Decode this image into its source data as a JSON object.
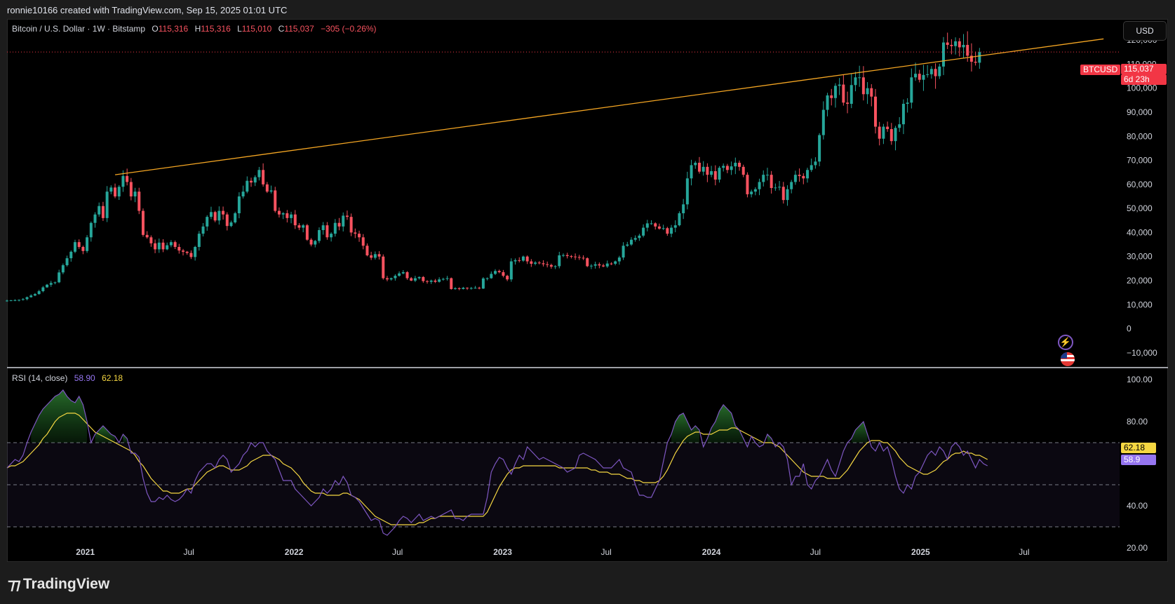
{
  "header": {
    "credit": "ronnie10166 created with TradingView.com, Sep 15, 2025 01:01 UTC"
  },
  "legend": {
    "symbol": "Bitcoin / U.S. Dollar · 1W · Bitstamp",
    "o_label": "O",
    "o_value": "115,316",
    "h_label": "H",
    "h_value": "115,316",
    "l_label": "L",
    "l_value": "115,010",
    "c_label": "C",
    "c_value": "115,037",
    "change": "−305 (−0.26%)"
  },
  "currency_button": "USD",
  "price_tag": {
    "symbol": "BTCUSD",
    "price": "115,037",
    "countdown": "6d 23h"
  },
  "rsi_legend": {
    "title": "RSI (14, close)",
    "rsi": "58.90",
    "ma": "62.18"
  },
  "footer": {
    "brand": "TradingView"
  },
  "colors": {
    "up": "#26a69a",
    "down": "#f7525f",
    "trendline": "#f5a623",
    "rsi_line": "#7e57c2",
    "rsi_ma": "#f5d742"
  },
  "chart_data": [
    {
      "type": "candlestick",
      "ylim": [
        -15000,
        125000
      ],
      "y_ticks": [
        "120,000",
        "110,000",
        "100,000",
        "90,000",
        "80,000",
        "70,000",
        "60,000",
        "50,000",
        "40,000",
        "30,000",
        "20,000",
        "10,000",
        "0",
        "−10,000"
      ],
      "y_tick_values": [
        120000,
        110000,
        100000,
        90000,
        80000,
        70000,
        60000,
        50000,
        40000,
        30000,
        20000,
        10000,
        0,
        -10000
      ],
      "x_ticks": [
        "2021",
        "Jul",
        "2022",
        "Jul",
        "2023",
        "Jul",
        "2024",
        "Jul",
        "2025",
        "Jul"
      ],
      "x_tick_dates": [
        "2021-01-01",
        "2021-07-01",
        "2022-01-01",
        "2022-07-01",
        "2023-01-01",
        "2023-07-01",
        "2024-01-01",
        "2024-07-01",
        "2025-01-01",
        "2025-07-01"
      ],
      "x_range": [
        "2020-08-17",
        "2025-12-15"
      ],
      "last_price": 115037,
      "trendline": [
        [
          "2021-02-22",
          64000
        ],
        [
          "2025-11-17",
          120500
        ]
      ],
      "weekly_closes": [
        11700,
        11800,
        11900,
        12000,
        12300,
        13100,
        13800,
        14400,
        15600,
        17200,
        18300,
        19000,
        19300,
        23400,
        26400,
        29300,
        32000,
        36000,
        34000,
        32300,
        38000,
        44000,
        47500,
        51000,
        46000,
        57000,
        58700,
        55000,
        59000,
        63500,
        61000,
        55000,
        57000,
        49000,
        39000,
        38000,
        35500,
        33000,
        35800,
        33000,
        34700,
        36000,
        34000,
        32500,
        32000,
        31500,
        29800,
        34000,
        39500,
        42500,
        46500,
        48500,
        45000,
        49000,
        47500,
        42700,
        44200,
        48000,
        55000,
        57000,
        61500,
        60800,
        63000,
        66000,
        60000,
        57000,
        57500,
        49000,
        47500,
        48000,
        46000,
        47500,
        43000,
        42000,
        43000,
        37000,
        35000,
        36500,
        41000,
        43000,
        38000,
        39500,
        44000,
        42500,
        47000,
        46500,
        40000,
        39500,
        38000,
        34500,
        30500,
        29500,
        31000,
        30000,
        21000,
        20500,
        21000,
        22000,
        23000,
        23500,
        21000,
        20000,
        21000,
        21500,
        19800,
        19500,
        20000,
        19500,
        20500,
        20700,
        21000,
        16500,
        16800,
        16500,
        17000,
        16800,
        16900,
        17000,
        16700,
        20900,
        21000,
        22800,
        24000,
        23500,
        22000,
        20500,
        28000,
        28500,
        28300,
        30000,
        28000,
        27000,
        27500,
        27200,
        26800,
        26500,
        25800,
        26000,
        30500,
        30600,
        30200,
        30000,
        29800,
        29500,
        29300,
        26000,
        26200,
        26800,
        26300,
        25900,
        27100,
        27000,
        28000,
        29600,
        34500,
        35000,
        37000,
        37700,
        38700,
        42000,
        43800,
        43800,
        42500,
        41600,
        41800,
        39500,
        42000,
        43000,
        48000,
        51700,
        62500,
        68000,
        69000,
        65300,
        67300,
        64000,
        65500,
        62000,
        66900,
        67700,
        66000,
        67500,
        69000,
        67300,
        64000,
        55900,
        57000,
        58000,
        61000,
        64000,
        64000,
        58500,
        58700,
        59000,
        53500,
        58000,
        61000,
        64000,
        63500,
        62500,
        66000,
        68000,
        69500,
        80500,
        91000,
        97000,
        95900,
        101000,
        101500,
        94000,
        93500,
        101300,
        104500,
        104500,
        97500,
        100000,
        96500,
        84000,
        79000,
        84000,
        83000,
        78000,
        83500,
        85000,
        93500,
        94000,
        104500,
        106000,
        103500,
        105500,
        105800,
        108000,
        105000,
        109000,
        119000,
        118000,
        117500,
        119500,
        117000,
        118000,
        113500,
        111000,
        110600,
        115000
      ]
    },
    {
      "type": "line",
      "title": "RSI (14, close)",
      "ylim": [
        15,
        105
      ],
      "y_ticks": [
        "100.00",
        "80.00",
        "40.00",
        "20.00"
      ],
      "y_tick_values": [
        100,
        80,
        40,
        20
      ],
      "bands": {
        "upper": 70,
        "middle": 50,
        "lower": 30
      },
      "current": {
        "rsi": 58.9,
        "ma": 62.18
      },
      "series": [
        {
          "name": "RSI",
          "values": [
            58,
            60,
            62,
            61,
            64,
            70,
            75,
            79,
            83,
            86,
            88,
            90,
            92,
            93,
            95,
            92,
            90,
            89,
            92,
            88,
            80,
            70,
            74,
            76,
            78,
            76,
            74,
            73,
            70,
            74,
            72,
            65,
            65,
            63,
            53,
            46,
            42,
            42,
            44,
            43,
            45,
            43,
            42,
            43,
            45,
            48,
            46,
            52,
            56,
            58,
            60,
            60,
            58,
            62,
            64,
            62,
            56,
            58,
            60,
            64,
            66,
            70,
            68,
            70,
            70,
            66,
            64,
            62,
            57,
            52,
            52,
            52,
            48,
            46,
            44,
            42,
            40,
            42,
            44,
            48,
            46,
            48,
            52,
            50,
            54,
            51,
            45,
            44,
            42,
            39,
            36,
            33,
            34,
            33,
            27,
            26,
            28,
            30,
            33,
            35,
            34,
            32,
            34,
            36,
            33,
            34,
            35,
            34,
            35,
            36,
            37,
            38,
            34,
            34,
            33,
            35,
            36,
            36,
            36,
            36,
            44,
            56,
            60,
            63,
            62,
            58,
            55,
            60,
            64,
            62,
            68,
            66,
            64,
            62,
            63,
            62,
            61,
            60,
            59,
            58,
            56,
            57,
            58,
            64,
            65,
            64,
            63,
            62,
            60,
            58,
            58,
            58,
            60,
            62,
            58,
            57,
            56,
            50,
            45,
            45,
            44,
            44,
            48,
            52,
            61,
            70,
            74,
            80,
            83,
            84,
            80,
            76,
            78,
            76,
            68,
            72,
            77,
            80,
            85,
            88,
            86,
            84,
            78,
            76,
            72,
            68,
            73,
            70,
            68,
            69,
            74,
            72,
            68,
            70,
            68,
            62,
            50,
            54,
            54,
            60,
            50,
            48,
            52,
            54,
            58,
            62,
            57,
            54,
            60,
            66,
            70,
            72,
            76,
            78,
            80,
            74,
            68,
            66,
            70,
            66,
            68,
            62,
            54,
            48,
            46,
            50,
            48,
            54,
            56,
            60,
            64,
            66,
            64,
            68,
            66,
            62,
            68,
            70,
            68,
            64,
            66,
            62,
            58,
            62,
            60,
            59
          ]
        },
        {
          "name": "MA",
          "values": [
            58,
            59,
            59,
            60,
            61,
            63,
            65,
            67,
            69,
            72,
            74,
            77,
            80,
            82,
            83,
            84,
            84,
            84,
            83,
            81,
            79,
            77,
            75,
            74,
            73,
            72,
            71,
            70,
            69,
            68,
            67,
            66,
            64,
            61,
            59,
            56,
            53,
            51,
            49,
            47,
            47,
            46,
            46,
            46,
            47,
            48,
            48,
            50,
            52,
            54,
            56,
            57,
            58,
            59,
            59,
            58,
            57,
            57,
            57,
            58,
            59,
            61,
            62,
            63,
            64,
            64,
            64,
            63,
            62,
            60,
            59,
            58,
            56,
            54,
            51,
            49,
            47,
            46,
            46,
            46,
            45,
            45,
            45,
            45,
            46,
            46,
            45,
            44,
            43,
            41,
            39,
            37,
            35,
            34,
            33,
            32,
            31,
            31,
            31,
            31,
            31,
            31,
            31,
            32,
            32,
            33,
            34,
            34,
            35,
            35,
            35,
            35,
            35,
            35,
            35,
            35,
            35,
            35,
            35,
            35,
            37,
            41,
            45,
            49,
            52,
            55,
            57,
            58,
            58,
            59,
            59,
            59,
            59,
            59,
            59,
            59,
            59,
            59,
            58,
            58,
            58,
            58,
            58,
            58,
            58,
            58,
            57,
            57,
            56,
            56,
            56,
            55,
            55,
            55,
            54,
            53,
            53,
            52,
            52,
            51,
            51,
            51,
            51,
            52,
            54,
            57,
            61,
            65,
            68,
            71,
            73,
            74,
            75,
            75,
            74,
            74,
            74,
            75,
            76,
            76,
            76,
            77,
            77,
            76,
            75,
            74,
            73,
            72,
            71,
            70,
            70,
            70,
            69,
            68,
            66,
            64,
            62,
            60,
            58,
            56,
            55,
            54,
            54,
            54,
            54,
            53,
            53,
            53,
            53,
            55,
            57,
            60,
            63,
            66,
            68,
            70,
            71,
            71,
            71,
            70,
            70,
            68,
            66,
            63,
            61,
            59,
            58,
            57,
            56,
            55,
            55,
            56,
            57,
            59,
            61,
            62,
            64,
            65,
            65,
            66,
            65,
            65,
            64,
            64,
            63,
            62
          ]
        }
      ]
    }
  ]
}
